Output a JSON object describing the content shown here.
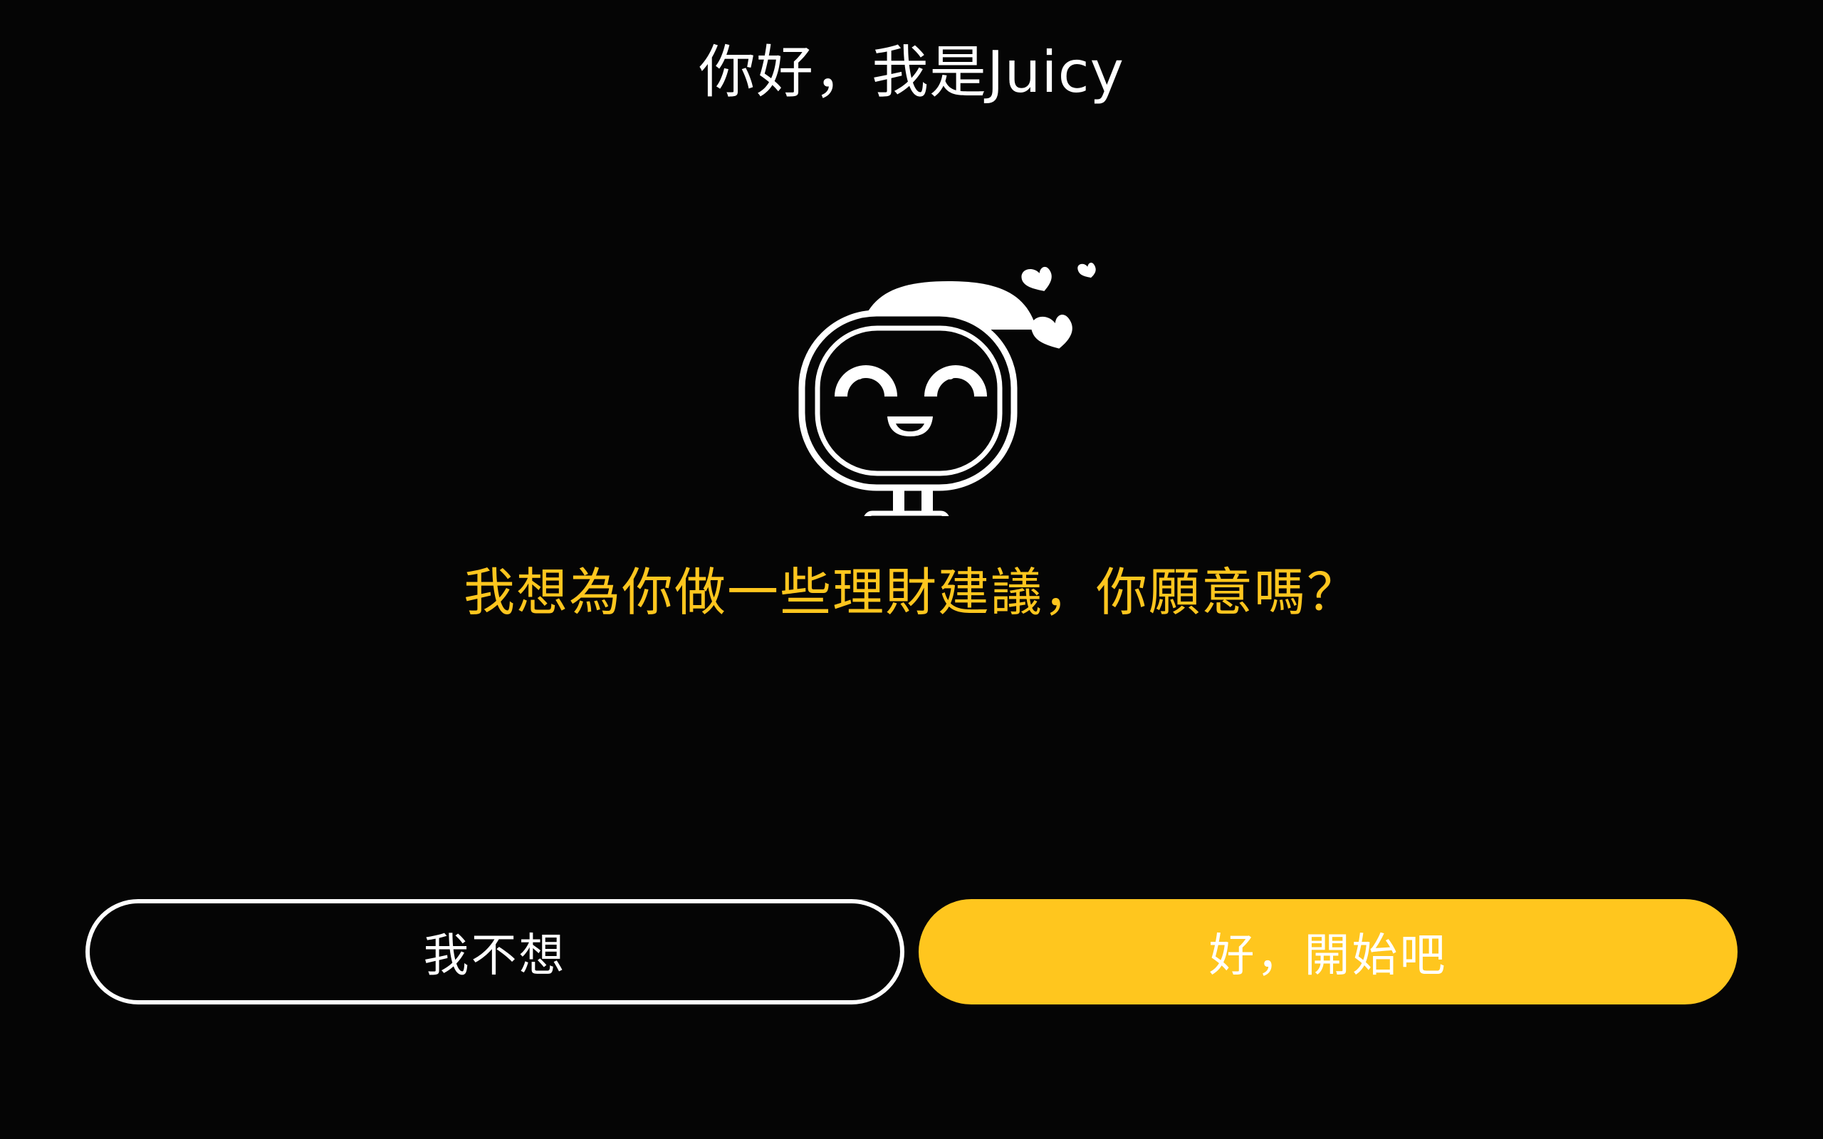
{
  "header": {
    "title": "你好，我是Juicy"
  },
  "mascot": {
    "name": "robot-mascot",
    "decorations": [
      "heart-icon",
      "heart-icon",
      "heart-icon"
    ]
  },
  "prompt": {
    "text": "我想為你做一些理財建議，你願意嗎？"
  },
  "actions": {
    "decline_label": "我不想",
    "accept_label": "好，開始吧"
  },
  "colors": {
    "background": "#050505",
    "accent": "#FFC61E",
    "text": "#FFFFFF"
  }
}
